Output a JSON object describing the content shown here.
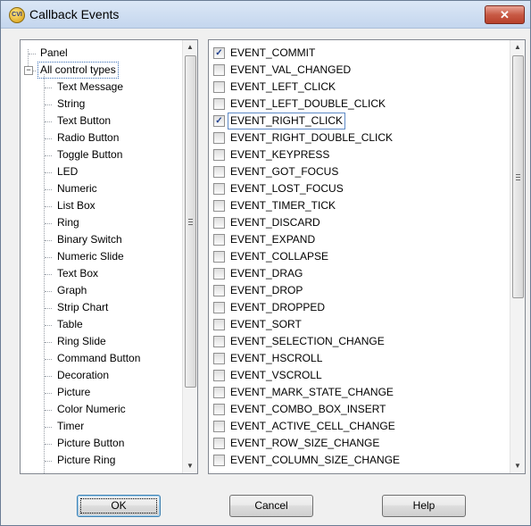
{
  "window": {
    "title": "Callback Events",
    "icon": "cvi-app-icon",
    "close_label": "✕"
  },
  "tree": {
    "items": [
      {
        "label": "Panel",
        "level": 0
      },
      {
        "label": "All control types",
        "level": 0,
        "expanded": true,
        "selected": true
      },
      {
        "label": "Text Message",
        "level": 1
      },
      {
        "label": "String",
        "level": 1
      },
      {
        "label": "Text Button",
        "level": 1
      },
      {
        "label": "Radio Button",
        "level": 1
      },
      {
        "label": "Toggle Button",
        "level": 1
      },
      {
        "label": "LED",
        "level": 1
      },
      {
        "label": "Numeric",
        "level": 1
      },
      {
        "label": "List Box",
        "level": 1
      },
      {
        "label": "Ring",
        "level": 1
      },
      {
        "label": "Binary Switch",
        "level": 1
      },
      {
        "label": "Numeric Slide",
        "level": 1
      },
      {
        "label": "Text Box",
        "level": 1
      },
      {
        "label": "Graph",
        "level": 1
      },
      {
        "label": "Strip Chart",
        "level": 1
      },
      {
        "label": "Table",
        "level": 1
      },
      {
        "label": "Ring Slide",
        "level": 1
      },
      {
        "label": "Command Button",
        "level": 1
      },
      {
        "label": "Decoration",
        "level": 1
      },
      {
        "label": "Picture",
        "level": 1
      },
      {
        "label": "Color Numeric",
        "level": 1
      },
      {
        "label": "Timer",
        "level": 1
      },
      {
        "label": "Picture Button",
        "level": 1
      },
      {
        "label": "Picture Ring",
        "level": 1
      }
    ],
    "scroll_position": 0.45
  },
  "events": {
    "items": [
      {
        "label": "EVENT_COMMIT",
        "checked": true
      },
      {
        "label": "EVENT_VAL_CHANGED",
        "checked": false
      },
      {
        "label": "EVENT_LEFT_CLICK",
        "checked": false
      },
      {
        "label": "EVENT_LEFT_DOUBLE_CLICK",
        "checked": false
      },
      {
        "label": "EVENT_RIGHT_CLICK",
        "checked": true,
        "focused": true
      },
      {
        "label": "EVENT_RIGHT_DOUBLE_CLICK",
        "checked": false
      },
      {
        "label": "EVENT_KEYPRESS",
        "checked": false
      },
      {
        "label": "EVENT_GOT_FOCUS",
        "checked": false
      },
      {
        "label": "EVENT_LOST_FOCUS",
        "checked": false
      },
      {
        "label": "EVENT_TIMER_TICK",
        "checked": false
      },
      {
        "label": "EVENT_DISCARD",
        "checked": false
      },
      {
        "label": "EVENT_EXPAND",
        "checked": false
      },
      {
        "label": "EVENT_COLLAPSE",
        "checked": false
      },
      {
        "label": "EVENT_DRAG",
        "checked": false
      },
      {
        "label": "EVENT_DROP",
        "checked": false
      },
      {
        "label": "EVENT_DROPPED",
        "checked": false
      },
      {
        "label": "EVENT_SORT",
        "checked": false
      },
      {
        "label": "EVENT_SELECTION_CHANGE",
        "checked": false
      },
      {
        "label": "EVENT_HSCROLL",
        "checked": false
      },
      {
        "label": "EVENT_VSCROLL",
        "checked": false
      },
      {
        "label": "EVENT_MARK_STATE_CHANGE",
        "checked": false
      },
      {
        "label": "EVENT_COMBO_BOX_INSERT",
        "checked": false
      },
      {
        "label": "EVENT_ACTIVE_CELL_CHANGE",
        "checked": false
      },
      {
        "label": "EVENT_ROW_SIZE_CHANGE",
        "checked": false
      },
      {
        "label": "EVENT_COLUMN_SIZE_CHANGE",
        "checked": false
      }
    ],
    "scroll_position": 0.3
  },
  "buttons": {
    "ok": "OK",
    "cancel": "Cancel",
    "help": "Help"
  },
  "colors": {
    "title_gradient_top": "#dbe7f6",
    "close_red": "#c85a45",
    "focus_blue": "#5d89c6",
    "check_blue": "#1b3f8f"
  }
}
